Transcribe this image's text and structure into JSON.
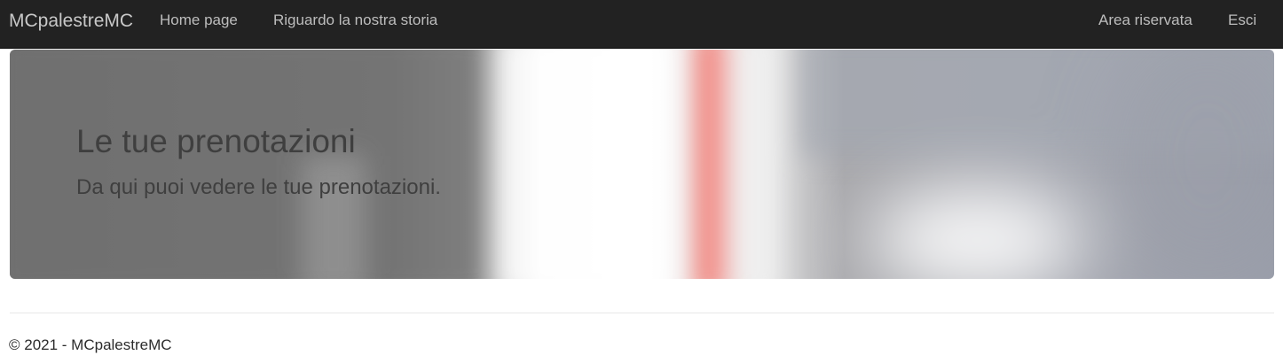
{
  "navbar": {
    "brand": "MCpalestreMC",
    "links": [
      {
        "label": "Home page"
      },
      {
        "label": "Riguardo la nostra storia"
      }
    ],
    "right_links": [
      {
        "label": "Area riservata"
      },
      {
        "label": "Esci"
      }
    ],
    "background_color": "#222222",
    "link_color": "#bdbdbd"
  },
  "hero": {
    "title": "Le tue prenotazioni",
    "subtitle": "Da qui puoi vedere le tue prenotazioni."
  },
  "footer": {
    "text": "© 2021 - MCpalestreMC"
  }
}
